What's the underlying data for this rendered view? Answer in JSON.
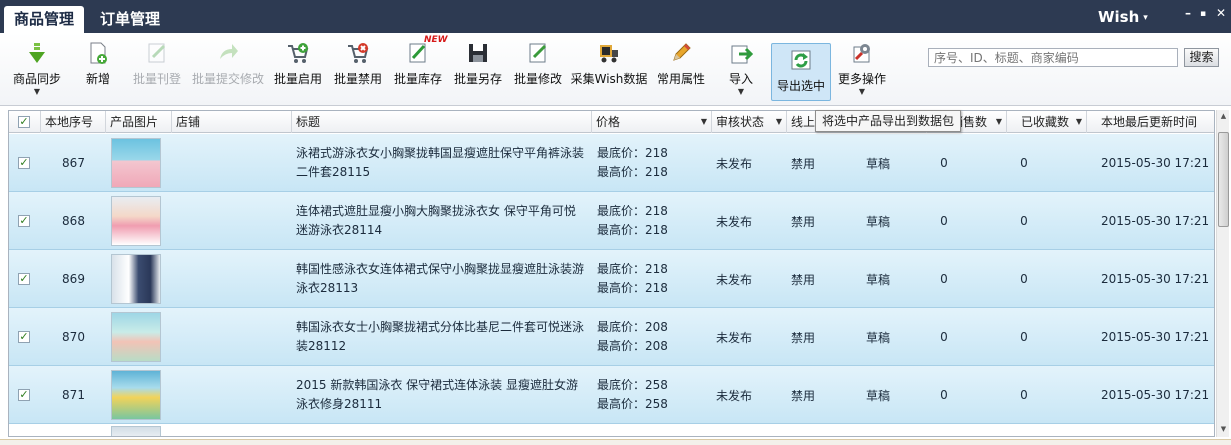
{
  "tabs": [
    {
      "label": "商品管理",
      "active": true
    },
    {
      "label": "订单管理",
      "active": false
    }
  ],
  "account": {
    "name": "Wish",
    "caret": "▾"
  },
  "window_controls": {
    "minimize": "–",
    "restore": "▪",
    "close": "✕"
  },
  "toolbar": {
    "sync": "商品同步",
    "add": "新增",
    "batch_publish": "批量刊登",
    "batch_submit": "批量提交修改",
    "batch_enable": "批量启用",
    "batch_disable": "批量禁用",
    "batch_stock": "批量库存",
    "new_badge": "NEW",
    "batch_saveas": "批量另存",
    "batch_edit": "批量修改",
    "collect": "采集Wish数据",
    "common_attr": "常用属性",
    "import": "导入",
    "export_selected": "导出选中",
    "more": "更多操作",
    "dropdown_caret": "▼"
  },
  "search": {
    "placeholder": "序号、ID、标题、商家编码",
    "button": "搜索"
  },
  "tooltip": "将选中产品导出到数据包",
  "columns": {
    "local_id": "本地序号",
    "image": "产品图片",
    "shop": "店铺",
    "title": "标题",
    "price": "价格",
    "review": "审核状态",
    "online": "线上",
    "sales": "销售数",
    "favorites": "已收藏数",
    "updated": "本地最后更新时间",
    "header_caret": "▼"
  },
  "rows": [
    {
      "id": "867",
      "title1": "泳裙式游泳衣女小胸聚拢韩国显瘦遮肚保守平角裤泳装",
      "title2": "二件套28115",
      "price_min": "最底价：218",
      "price_max": "最高价：218",
      "review": "未发布",
      "online": "禁用",
      "status": "草稿",
      "sales": "0",
      "favorites": "0",
      "updated": "2015-05-30 17:21",
      "check": "✓"
    },
    {
      "id": "868",
      "title1": "连体裙式遮肚显瘦小胸大胸聚拢泳衣女 保守平角可悦",
      "title2": "迷游泳衣28114",
      "price_min": "最底价：218",
      "price_max": "最高价：218",
      "review": "未发布",
      "online": "禁用",
      "status": "草稿",
      "sales": "0",
      "favorites": "0",
      "updated": "2015-05-30 17:21",
      "check": "✓"
    },
    {
      "id": "869",
      "title1": "韩国性感泳衣女连体裙式保守小胸聚拢显瘦遮肚泳装游",
      "title2": "泳衣28113",
      "price_min": "最底价：218",
      "price_max": "最高价：218",
      "review": "未发布",
      "online": "禁用",
      "status": "草稿",
      "sales": "0",
      "favorites": "0",
      "updated": "2015-05-30 17:21",
      "check": "✓"
    },
    {
      "id": "870",
      "title1": "韩国泳衣女士小胸聚拢裙式分体比基尼二件套可悦迷泳",
      "title2": "装28112",
      "price_min": "最底价：208",
      "price_max": "最高价：208",
      "review": "未发布",
      "online": "禁用",
      "status": "草稿",
      "sales": "0",
      "favorites": "0",
      "updated": "2015-05-30 17:21",
      "check": "✓"
    },
    {
      "id": "871",
      "title1": "2015 新款韩国泳衣 保守裙式连体泳装 显瘦遮肚女游",
      "title2": "泳衣修身28111",
      "price_min": "最底价：258",
      "price_max": "最高价：258",
      "review": "未发布",
      "online": "禁用",
      "status": "草稿",
      "sales": "0",
      "favorites": "0",
      "updated": "2015-05-30 17:21",
      "check": "✓"
    }
  ],
  "header_check": "✓",
  "scroll": {
    "up": "▲",
    "down": "▼"
  },
  "colors": {
    "titlebar": "#2d3a52",
    "row_gradient_top": "#e3f3fb",
    "row_gradient_bottom": "#c8e6f5",
    "tooltip_bg": "#f6f6f6",
    "new_badge": "#d61a1a"
  }
}
